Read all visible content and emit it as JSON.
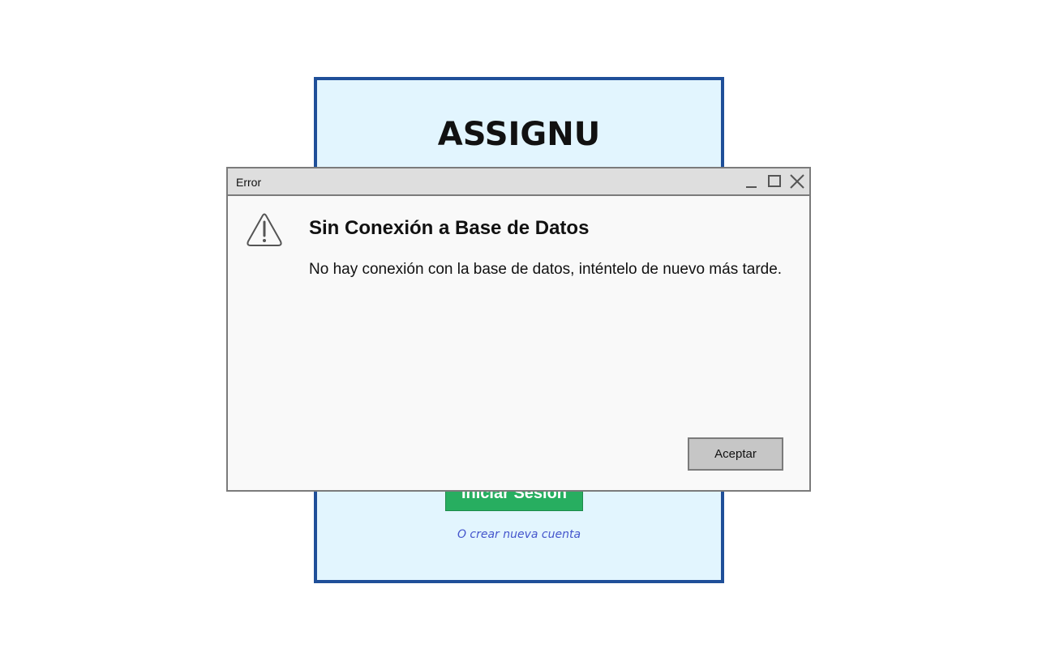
{
  "app": {
    "title": "ASSIGNU",
    "login_button_label": "Iniciar Sesión",
    "create_account_link": "O crear nueva cuenta",
    "colors": {
      "panel_bg": "#e2f5fe",
      "panel_border": "#1f4f99",
      "login_button": "#27ae60",
      "link": "#4455cc"
    }
  },
  "dialog": {
    "window_title": "Error",
    "heading": "Sin Conexión a Base de Datos",
    "message": "No hay conexión con la base de datos, inténtelo de nuevo más tarde.",
    "ok_button_label": "Aceptar",
    "icons": {
      "status": "warning-icon",
      "minimize": "minimize-icon",
      "maximize": "maximize-icon",
      "close": "close-icon"
    }
  }
}
